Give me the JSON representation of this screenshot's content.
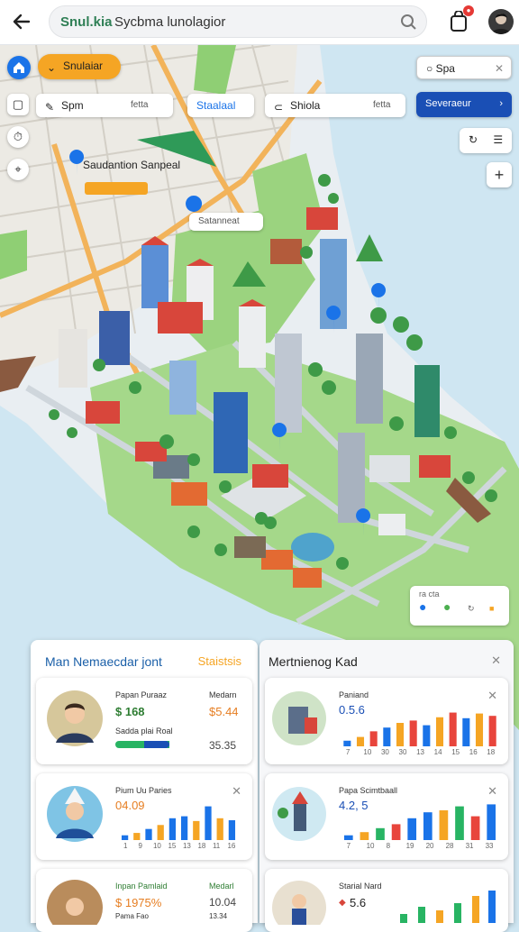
{
  "header": {
    "search_brand": "Snul.kia",
    "search_text": "Sycbma lunolagior"
  },
  "map_controls": {
    "simulate_label": "Snulaiar",
    "search_small": "Spa",
    "chip_spm": "Spm",
    "chip_spm_tag": "fetta",
    "chip_stalata": "Staalaal",
    "chip_shiola": "Shiola",
    "chip_shiola_tag": "fetta",
    "button_blue": "Severaeur",
    "map_label_1": "Saudantion Sanpeal",
    "map_label_2": "Satanneat",
    "mini_legend": "ra cta"
  },
  "panels": {
    "left_title": "Man Nemaecdar jont",
    "left_tab": "Staistsis",
    "right_title": "Mertnienog Kad"
  },
  "cards": [
    {
      "label": "Papan Puraaz",
      "value": "$ 168",
      "side_label": "Medarn",
      "side_value": "$5.44",
      "sub_label": "Sadda plai Roal",
      "sub_value": "35.35"
    },
    {
      "label": "Paniand",
      "value": "0.5.6",
      "ticks": [
        "7",
        "10",
        "30",
        "30",
        "13",
        "14",
        "15",
        "16",
        "18"
      ]
    },
    {
      "label": "Pium Uu Paries",
      "value": "04.09",
      "ticks": [
        "1",
        "9",
        "10",
        "15",
        "13",
        "18",
        "11",
        "16"
      ]
    },
    {
      "label": "Papa Scimtbaall",
      "value": "4.2, 5",
      "ticks": [
        "7",
        "10",
        "8",
        "19",
        "20",
        "28",
        "31",
        "33"
      ]
    },
    {
      "label": "Inpan Pamlaid",
      "value": "$ 1975%",
      "side_label": "Medarl",
      "side_value": "10.04",
      "sub_label": "Pama Fao",
      "sub_value": "13.34"
    },
    {
      "label": "Starial Nard",
      "value": "5.6"
    }
  ],
  "colors": {
    "accent_orange": "#f5a524",
    "accent_blue": "#1a73e8",
    "water": "#cfe6f2",
    "park": "#7cc46a"
  }
}
